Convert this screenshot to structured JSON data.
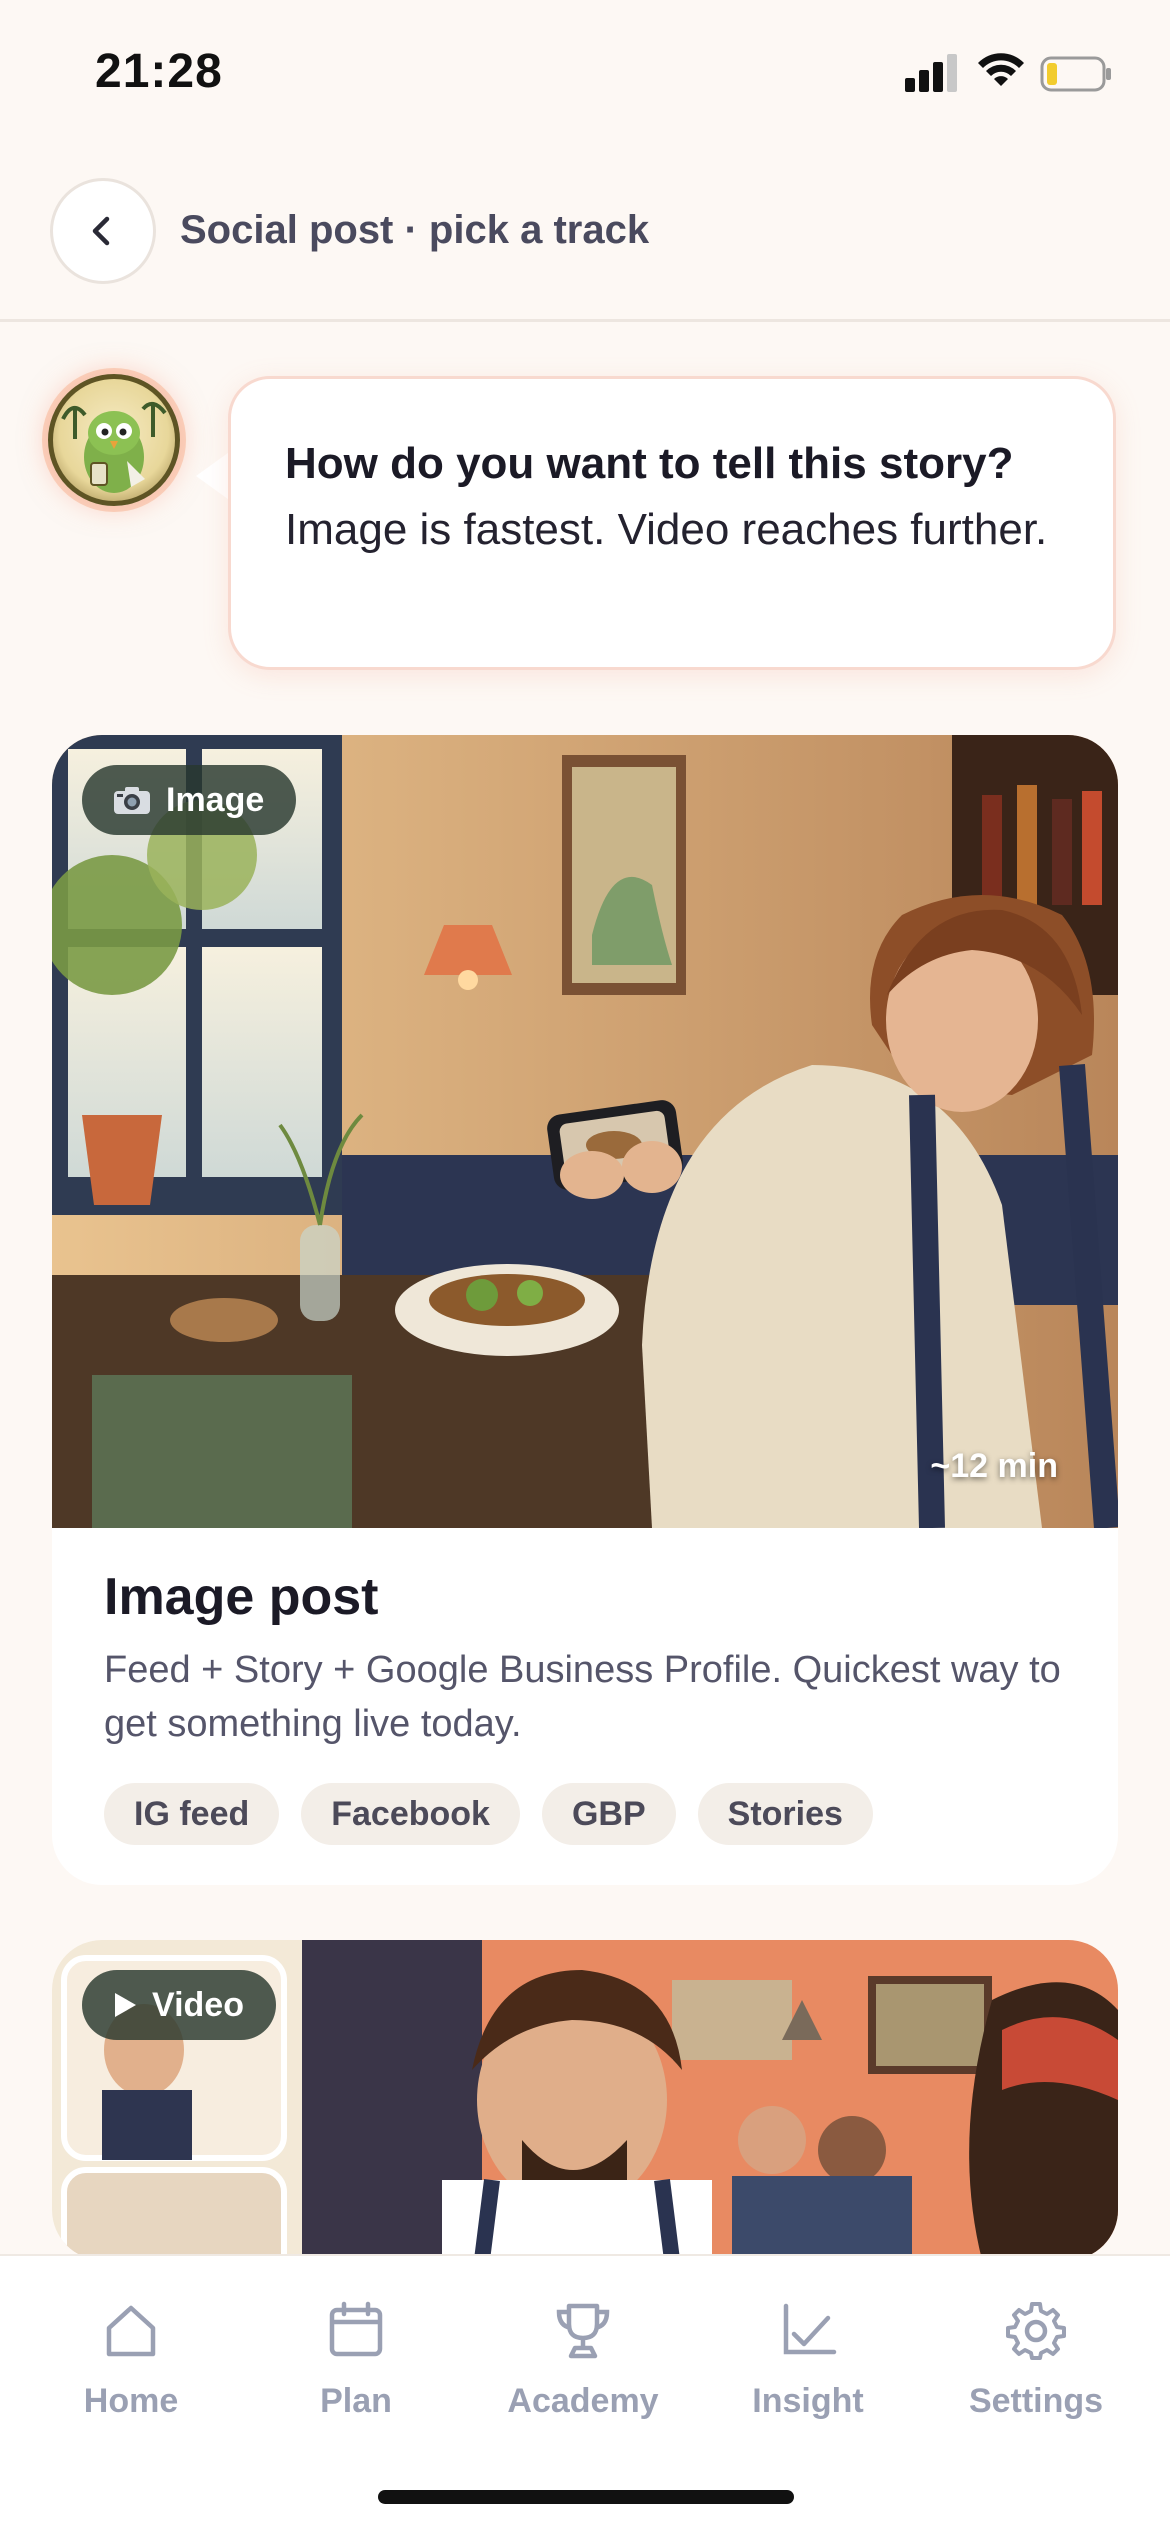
{
  "status_bar": {
    "time": "21:28"
  },
  "header": {
    "title": "Social post · pick a track"
  },
  "assistant": {
    "message_bold": "How do you want to tell this story?",
    "message_rest": " Image is fastest. Video reaches further."
  },
  "cards": [
    {
      "badge_label": "Image",
      "badge_icon": "camera-icon",
      "duration": "~12 min",
      "title": "Image post",
      "description": "Feed + Story + Google Business Profile. Quickest way to get something live today.",
      "chips": [
        "IG feed",
        "Facebook",
        "GBP",
        "Stories"
      ]
    },
    {
      "badge_label": "Video",
      "badge_icon": "play-icon"
    }
  ],
  "tab_bar": {
    "items": [
      {
        "label": "Home",
        "icon": "home-icon"
      },
      {
        "label": "Plan",
        "icon": "calendar-icon"
      },
      {
        "label": "Academy",
        "icon": "trophy-icon"
      },
      {
        "label": "Insight",
        "icon": "chart-icon"
      },
      {
        "label": "Settings",
        "icon": "gear-icon"
      }
    ]
  },
  "colors": {
    "background": "#FDF8F4",
    "accent": "#F0A58C",
    "tab_inactive": "#9AA0B3"
  }
}
